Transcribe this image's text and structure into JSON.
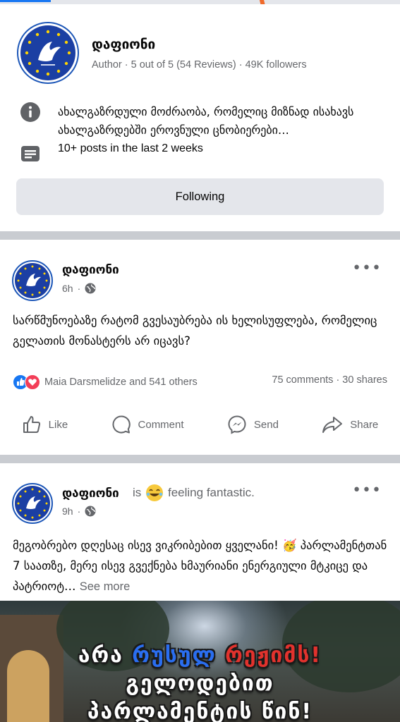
{
  "page": {
    "name": "დაფიონი",
    "meta": "Author · 5 out of 5 (54 Reviews) · 49K followers",
    "about": "ახალგაზრდული მოძრაობა, რომელიც მიზნად ისახავს ახალგაზრდებში ეროვნული ცნობიერები…",
    "posts_activity": "10+ posts in the last 2 weeks",
    "following_label": "Following"
  },
  "posts": [
    {
      "author": "დაფიონი",
      "time": "6h",
      "text": "სარწმუნოებაზე რატომ გვესაუბრება ის ხელისუფლება, რომელიც გელათის მონასტერს არ იცავს?",
      "reactions_text": "Maia Darsmelidze and 541 others",
      "counts": "75 comments · 30 shares",
      "actions": [
        "Like",
        "Comment",
        "Send",
        "Share"
      ]
    },
    {
      "author": "დაფიონი",
      "feeling_is": "is",
      "feeling": "feeling fantastic.",
      "time": "9h",
      "text": "მეგობრებო დღესაც ისევ ვიკრიბებით ყველანი! 🥳 პარლამენტთან 7 საათზე, მერე ისევ გვექნება ხმაურიანი ენერგიული მტკიცე და პატრიოტ…",
      "see_more": "See more",
      "banner": {
        "line1_a": "არა",
        "line1_b": "რუსულ",
        "line1_c": "რეჟიმს!",
        "line2": "გელოდებით",
        "line3": "პარლამენტის წინ!"
      }
    }
  ],
  "colors": {
    "accent": "#1877f2",
    "muted": "#65676b",
    "divider": "#c9ccd1",
    "button_bg": "#e4e6eb"
  }
}
